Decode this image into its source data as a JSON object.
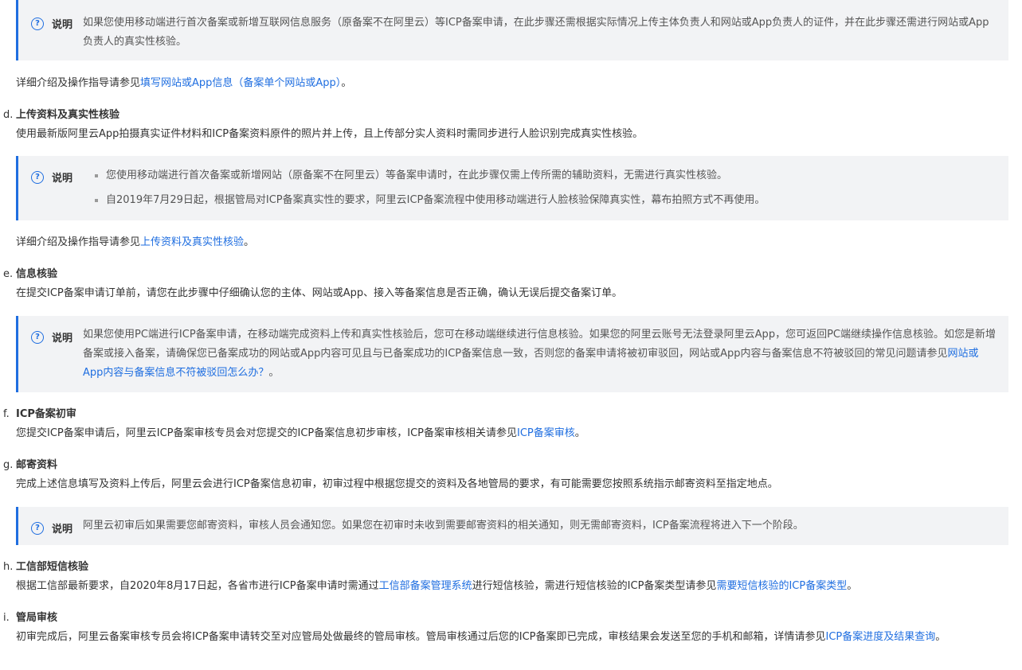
{
  "note_label": "说明",
  "note1": {
    "text": "如果您使用移动端进行首次备案或新增互联网信息服务（原备案不在阿里云）等ICP备案申请，在此步骤还需根据实际情况上传主体负责人和网站或App负责人的证件，并在此步骤还需进行网站或App负责人的真实性核验。"
  },
  "ref1": {
    "prefix": "详细介绍及操作指导请参见",
    "link": "填写网站或App信息（备案单个网站或App）",
    "suffix": "。"
  },
  "section_d": {
    "index": "d.",
    "title": "上传资料及真实性核验",
    "desc": "使用最新版阿里云App拍摄真实证件材料和ICP备案资料原件的照片并上传，且上传部分实人资料时需同步进行人脸识别完成真实性核验。"
  },
  "note2": {
    "items": [
      "您使用移动端进行首次备案或新增网站（原备案不在阿里云）等备案申请时，在此步骤仅需上传所需的辅助资料，无需进行真实性核验。",
      "自2019年7月29日起，根据管局对ICP备案真实性的要求，阿里云ICP备案流程中使用移动端进行人脸核验保障真实性，幕布拍照方式不再使用。"
    ]
  },
  "ref2": {
    "prefix": "详细介绍及操作指导请参见",
    "link": "上传资料及真实性核验",
    "suffix": "。"
  },
  "section_e": {
    "index": "e.",
    "title": "信息核验",
    "desc": "在提交ICP备案申请订单前，请您在此步骤中仔细确认您的主体、网站或App、接入等备案信息是否正确，确认无误后提交备案订单。"
  },
  "note3": {
    "text": "如果您使用PC端进行ICP备案申请，在移动端完成资料上传和真实性核验后，您可在移动端继续进行信息核验。如果您的阿里云账号无法登录阿里云App，您可返回PC端继续操作信息核验。如您是新增备案或接入备案，请确保您已备案成功的网站或App内容可见且与已备案成功的ICP备案信息一致，否则您的备案申请将被初审驳回，网站或App内容与备案信息不符被驳回的常见问题请参见",
    "link": "网站或App内容与备案信息不符被驳回怎么办？",
    "suffix": "。"
  },
  "section_f": {
    "index": "f.",
    "title": "ICP备案初审",
    "desc": "您提交ICP备案申请后，阿里云ICP备案审核专员会对您提交的ICP备案信息初步审核，ICP备案审核相关请参见",
    "link": "ICP备案审核",
    "suffix": "。"
  },
  "section_g": {
    "index": "g.",
    "title": "邮寄资料",
    "desc": "完成上述信息填写及资料上传后，阿里云会进行ICP备案信息初审，初审过程中根据您提交的资料及各地管局的要求，有可能需要您按照系统指示邮寄资料至指定地点。"
  },
  "note4": {
    "text": "阿里云初审后如果需要您邮寄资料，审核人员会通知您。如果您在初审时未收到需要邮寄资料的相关通知，则无需邮寄资料，ICP备案流程将进入下一个阶段。"
  },
  "section_h": {
    "index": "h.",
    "title": "工信部短信核验",
    "desc_a": "根据工信部最新要求，自2020年8月17日起，各省市进行ICP备案申请时需通过",
    "link_a": "工信部备案管理系统",
    "desc_b": "进行短信核验，需进行短信核验的ICP备案类型请参见",
    "link_b": "需要短信核验的ICP备案类型",
    "suffix": "。"
  },
  "section_i": {
    "index": "i.",
    "title": "管局审核",
    "desc": "初审完成后，阿里云备案审核专员会将ICP备案申请转交至对应管局处做最终的管局审核。管局审核通过后您的ICP备案即已完成，审核结果会发送至您的手机和邮箱，详情请参见",
    "link": "ICP备案进度及结果查询",
    "suffix": "。"
  },
  "colors": {
    "link": "#1f6ee0",
    "note_bg": "#f2f3f5",
    "note_border": "#1f6ee0"
  },
  "icons": {
    "note": "question-circle-icon"
  }
}
